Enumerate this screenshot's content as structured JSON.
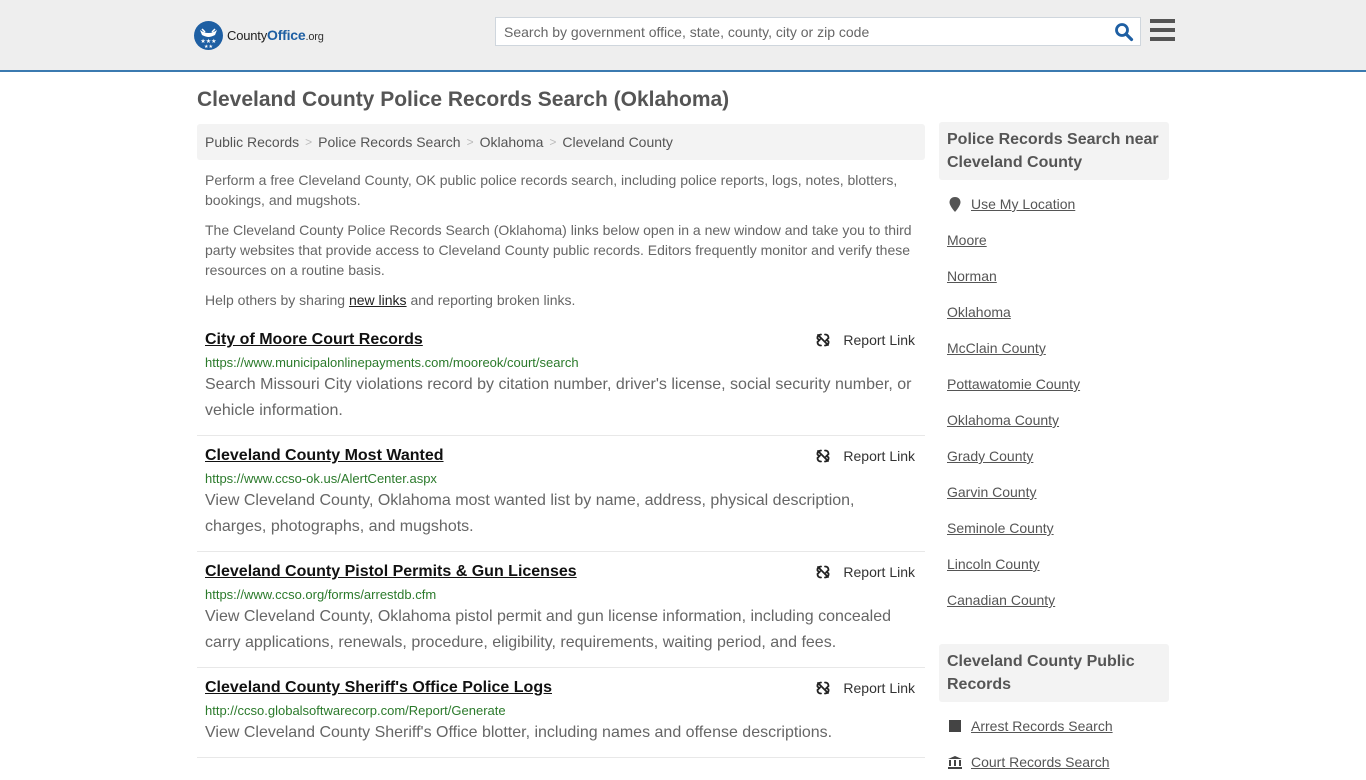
{
  "header": {
    "logo": {
      "name": "County",
      "office": "Office",
      "tld": ".org"
    },
    "search": {
      "placeholder": "Search by government office, state, county, city or zip code",
      "value": ""
    }
  },
  "page_title": "Cleveland County Police Records Search (Oklahoma)",
  "breadcrumb": [
    {
      "label": "Public Records"
    },
    {
      "label": "Police Records Search"
    },
    {
      "label": "Oklahoma"
    },
    {
      "label": "Cleveland County"
    }
  ],
  "intro": {
    "p1": "Perform a free Cleveland County, OK public police records search, including police reports, logs, notes, blotters, bookings, and mugshots.",
    "p2": "The Cleveland County Police Records Search (Oklahoma) links below open in a new window and take you to third party websites that provide access to Cleveland County public records. Editors frequently monitor and verify these resources on a routine basis.",
    "p3_before": "Help others by sharing ",
    "p3_link": "new links",
    "p3_after": " and reporting broken links."
  },
  "report_label": "Report Link",
  "results": [
    {
      "title": "City of Moore Court Records",
      "url": "https://www.municipalonlinepayments.com/mooreok/court/search",
      "description": "Search Missouri City violations record by citation number, driver's license, social security number, or vehicle information."
    },
    {
      "title": "Cleveland County Most Wanted",
      "url": "https://www.ccso-ok.us/AlertCenter.aspx",
      "description": "View Cleveland County, Oklahoma most wanted list by name, address, physical description, charges, photographs, and mugshots."
    },
    {
      "title": "Cleveland County Pistol Permits & Gun Licenses",
      "url": "https://www.ccso.org/forms/arrestdb.cfm",
      "description": "View Cleveland County, Oklahoma pistol permit and gun license information, including concealed carry applications, renewals, procedure, eligibility, requirements, waiting period, and fees."
    },
    {
      "title": "Cleveland County Sheriff's Office Police Logs",
      "url": "http://ccso.globalsoftwarecorp.com/Report/Generate",
      "description": "View Cleveland County Sheriff's Office blotter, including names and offense descriptions."
    }
  ],
  "sidebar": {
    "nearby": {
      "heading": "Police Records Search near Cleveland County",
      "use_location": "Use My Location",
      "items": [
        "Moore",
        "Norman",
        "Oklahoma",
        "McClain County",
        "Pottawatomie County",
        "Oklahoma County",
        "Grady County",
        "Garvin County",
        "Seminole County",
        "Lincoln County",
        "Canadian County"
      ]
    },
    "public_records": {
      "heading": "Cleveland County Public Records",
      "items": [
        {
          "label": "Arrest Records Search",
          "icon": "square-icon"
        },
        {
          "label": "Court Records Search",
          "icon": "courthouse-icon"
        }
      ]
    }
  },
  "colors": {
    "accent": "#3b7ab0",
    "brand": "#1e5fa3",
    "url_green": "#2b7a2b"
  }
}
